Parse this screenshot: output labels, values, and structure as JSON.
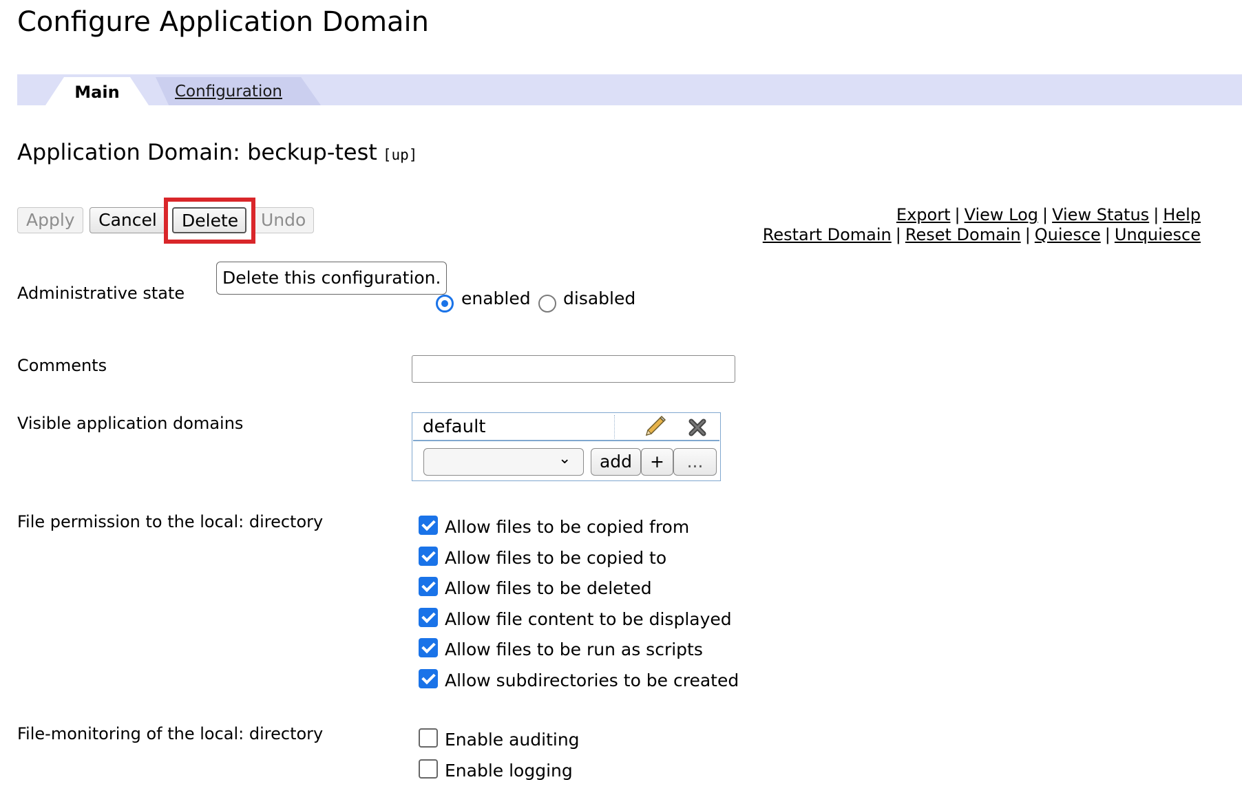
{
  "page": {
    "title": "Configure Application Domain"
  },
  "tabs": [
    {
      "label": "Main",
      "active": true
    },
    {
      "label": "Configuration",
      "active": false
    }
  ],
  "domain": {
    "heading": "Application Domain: beckup-test",
    "status": "[up]"
  },
  "toolbar": {
    "apply_label": "Apply",
    "cancel_label": "Cancel",
    "delete_label": "Delete",
    "undo_label": "Undo",
    "highlight_color": "#d9262a"
  },
  "tooltip": {
    "text": "Delete this configuration."
  },
  "links": {
    "row1": [
      "Export",
      "View Log",
      "View Status",
      "Help"
    ],
    "row2": [
      "Restart Domain",
      "Reset Domain",
      "Quiesce",
      "Unquiesce"
    ],
    "separator": "|"
  },
  "form": {
    "admin_state": {
      "label": "Administrative state",
      "options": [
        "enabled",
        "disabled"
      ],
      "selected": "enabled"
    },
    "comments": {
      "label": "Comments",
      "value": ""
    },
    "visible_domains": {
      "label": "Visible application domains",
      "items": [
        "default"
      ],
      "add_label": "add",
      "plus_label": "+",
      "more_label": "..."
    },
    "file_permission": {
      "label": "File permission to the local: directory",
      "options": [
        {
          "label": "Allow files to be copied from",
          "checked": true
        },
        {
          "label": "Allow files to be copied to",
          "checked": true
        },
        {
          "label": "Allow files to be deleted",
          "checked": true
        },
        {
          "label": "Allow file content to be displayed",
          "checked": true
        },
        {
          "label": "Allow files to be run as scripts",
          "checked": true
        },
        {
          "label": "Allow subdirectories to be created",
          "checked": true
        }
      ]
    },
    "file_monitoring": {
      "label": "File-monitoring of the local: directory",
      "options": [
        {
          "label": "Enable auditing",
          "checked": false
        },
        {
          "label": "Enable logging",
          "checked": false
        }
      ]
    }
  },
  "colors": {
    "accent": "#1a73e8",
    "tabbar": "#dcdff7"
  }
}
